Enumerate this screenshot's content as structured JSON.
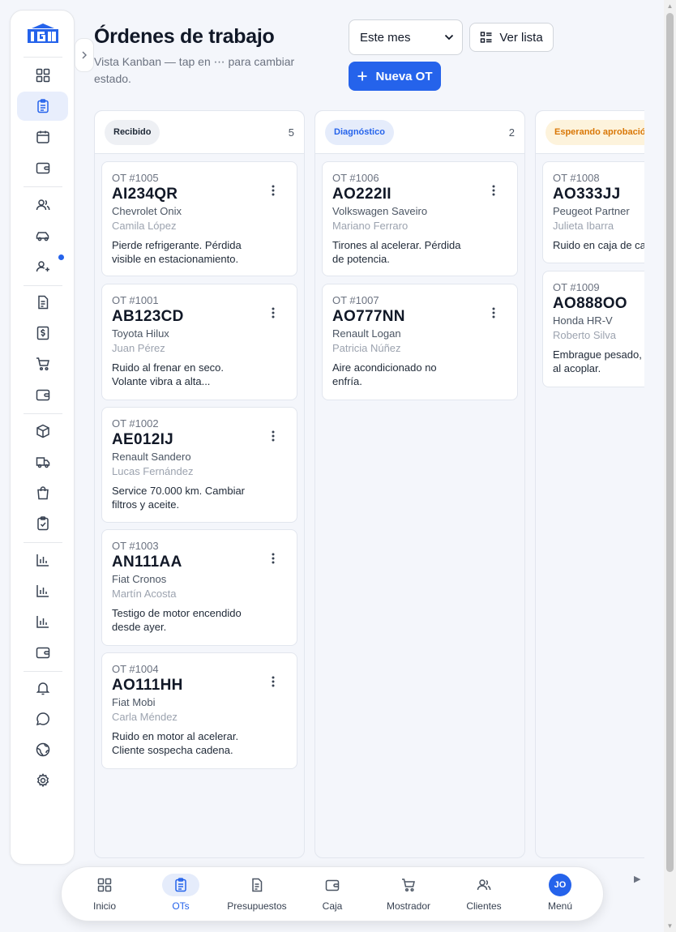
{
  "page": {
    "title": "Órdenes de trabajo",
    "subtitle": "Vista Kanban — tap en ⋯ para cambiar estado."
  },
  "toolbar": {
    "period_value": "Este mes",
    "list_label": "Ver lista",
    "new_label": "Nueva OT"
  },
  "sidebar": {
    "collapse_icon": "chevron-right-icon",
    "items": [
      {
        "icon": "dashboard-grid-icon"
      },
      {
        "icon": "clipboard-list-icon",
        "active": true
      },
      {
        "icon": "calendar-icon"
      },
      {
        "icon": "wallet-icon"
      },
      {
        "icon": "users-icon"
      },
      {
        "icon": "car-icon"
      },
      {
        "icon": "user-plus-icon",
        "badge": true
      },
      {
        "icon": "document-icon"
      },
      {
        "icon": "dollar-document-icon"
      },
      {
        "icon": "cart-icon"
      },
      {
        "icon": "wallet-icon"
      },
      {
        "icon": "box-icon"
      },
      {
        "icon": "truck-icon"
      },
      {
        "icon": "shopping-bag-icon"
      },
      {
        "icon": "clipboard-check-icon"
      },
      {
        "icon": "bar-chart-icon"
      },
      {
        "icon": "bar-chart-icon"
      },
      {
        "icon": "bar-chart-icon"
      },
      {
        "icon": "wallet-icon"
      },
      {
        "icon": "bell-icon"
      },
      {
        "icon": "chat-icon"
      },
      {
        "icon": "globe-icon"
      },
      {
        "icon": "settings-icon"
      }
    ]
  },
  "columns": [
    {
      "name": "Recibido",
      "count": "5",
      "cards": [
        {
          "ot": "OT #1005",
          "plate": "AI234QR",
          "vehicle": "Chevrolet Onix",
          "client": "Camila López",
          "desc": "Pierde refrigerante. Pérdida\nvisible en estacionamiento."
        },
        {
          "ot": "OT #1001",
          "plate": "AB123CD",
          "vehicle": "Toyota Hilux",
          "client": "Juan Pérez",
          "desc": "Ruido al frenar en seco.\nVolante vibra a alta..."
        },
        {
          "ot": "OT #1002",
          "plate": "AE012IJ",
          "vehicle": "Renault Sandero",
          "client": "Lucas Fernández",
          "desc": "Service 70.000 km. Cambiar\nfiltros y aceite."
        },
        {
          "ot": "OT #1003",
          "plate": "AN111AA",
          "vehicle": "Fiat Cronos",
          "client": "Martín Acosta",
          "desc": "Testigo de motor encendido\ndesde ayer."
        },
        {
          "ot": "OT #1004",
          "plate": "AO111HH",
          "vehicle": "Fiat Mobi",
          "client": "Carla Méndez",
          "desc": "Ruido en motor al acelerar.\nCliente sospecha cadena."
        }
      ]
    },
    {
      "name": "Diagnóstico",
      "count": "2",
      "cards": [
        {
          "ot": "OT #1006",
          "plate": "AO222II",
          "vehicle": "Volkswagen Saveiro",
          "client": "Mariano Ferraro",
          "desc": "Tirones al acelerar. Pérdida\nde potencia."
        },
        {
          "ot": "OT #1007",
          "plate": "AO777NN",
          "vehicle": "Renault Logan",
          "client": "Patricia Núñez",
          "desc": "Aire acondicionado no\nenfría."
        }
      ]
    },
    {
      "name": "Esperando aprobación",
      "count": "",
      "cards": [
        {
          "ot": "OT #1008",
          "plate": "AO333JJ",
          "vehicle": "Peugeot Partner",
          "client": "Julieta Ibarra",
          "desc": "Ruido en caja de cambios"
        },
        {
          "ot": "OT #1009",
          "plate": "AO888OO",
          "vehicle": "Honda HR-V",
          "client": "Roberto Silva",
          "desc": "Embrague pesado, vibra\nal acoplar."
        }
      ]
    }
  ],
  "bottom_nav": [
    {
      "label": "Inicio",
      "icon": "dashboard-grid-icon"
    },
    {
      "label": "OTs",
      "icon": "clipboard-list-icon",
      "active": true
    },
    {
      "label": "Presupuestos",
      "icon": "document-icon"
    },
    {
      "label": "Caja",
      "icon": "wallet-icon"
    },
    {
      "label": "Mostrador",
      "icon": "cart-icon"
    },
    {
      "label": "Clientes",
      "icon": "users-icon"
    },
    {
      "label": "Menú",
      "avatar": "JO"
    }
  ],
  "colors": {
    "accent": "#2563eb",
    "page_bg": "#f4f6fb",
    "waiting": "#d97706"
  }
}
